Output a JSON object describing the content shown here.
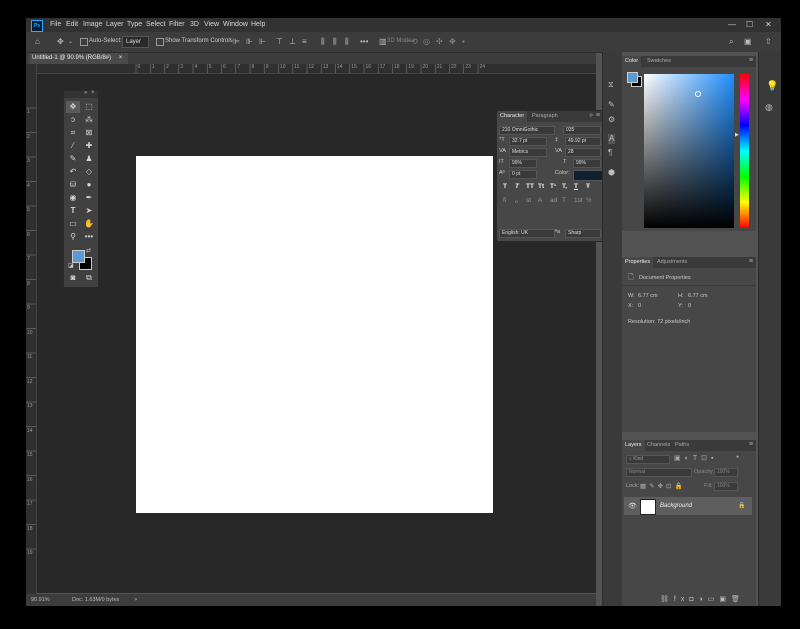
{
  "app": {
    "logo": "Ps",
    "menu": [
      "File",
      "Edit",
      "Image",
      "Layer",
      "Type",
      "Select",
      "Filter",
      "3D",
      "View",
      "Window",
      "Help"
    ],
    "window_controls": {
      "minimize": "—",
      "restore": "☐",
      "close": "✕"
    }
  },
  "options_bar": {
    "auto_select_label": "Auto-Select:",
    "auto_select_target": "Layer",
    "show_transform_label": "Show Transform Controls",
    "mode_3d_label": "3D Mode:"
  },
  "document": {
    "tab_title": "Untitled-1 @ 90.9% (RGB/8#)",
    "tab_close": "×",
    "ruler_h_marks": [
      "0",
      "1",
      "2",
      "3",
      "4",
      "5",
      "6",
      "7",
      "8",
      "9",
      "10",
      "11",
      "12",
      "13",
      "14",
      "15",
      "16",
      "17",
      "18",
      "19",
      "20",
      "21",
      "22",
      "23",
      "24"
    ],
    "ruler_v_marks": [
      "1",
      "2",
      "3",
      "4",
      "5",
      "6",
      "7",
      "8",
      "9",
      "10",
      "11",
      "12",
      "13",
      "14",
      "15",
      "16",
      "17",
      "18",
      "19"
    ],
    "canvas_color": "#ffffff"
  },
  "status": {
    "zoom": "90.91%",
    "doc_size": "Doc: 1.63M/0 bytes",
    "arrow": ">"
  },
  "colors": {
    "foreground": "#5b9bd5",
    "background": "#000000",
    "accent": "#31a8ff"
  },
  "character_panel": {
    "tab_character": "Character",
    "tab_paragraph": "Paragraph",
    "font_family": "210 OmniGothic",
    "font_style": "035",
    "font_size": "32.7 pt",
    "leading": "49.92 pt",
    "kerning": "Metrics",
    "tracking": "28",
    "vertical_scale": "99%",
    "horizontal_scale": "99%",
    "baseline_shift": "0 pt",
    "color_label": "Color:",
    "color_value": "#0f2033",
    "language": "English: UK",
    "aa_prefix": "ªa",
    "antialias": "Sharp",
    "format_buttons": [
      "T",
      "T",
      "TT",
      "Tt",
      "T¹",
      "T,",
      "T",
      "Ŧ"
    ],
    "opentype_buttons": [
      "fi",
      "ℴ",
      "st",
      "A",
      "ad",
      "T",
      "1st",
      "½"
    ]
  },
  "color_panel": {
    "tab_color": "Color",
    "tab_swatches": "Swatches"
  },
  "properties_panel": {
    "tab_properties": "Properties",
    "tab_adjustments": "Adjustments",
    "doc_props_label": "Document Properties",
    "w_label": "W:",
    "w_value": "6.77 cm",
    "h_label": "H:",
    "h_value": "6.77 cm",
    "x_label": "X:",
    "x_value": "0",
    "y_label": "Y:",
    "y_value": "0",
    "resolution": "Resolution: 72 pixels/inch"
  },
  "layers_panel": {
    "tab_layers": "Layers",
    "tab_channels": "Channels",
    "tab_paths": "Paths",
    "filter_kind": "Kind",
    "blend_mode": "Normal",
    "opacity_label": "Opacity:",
    "opacity_value": "100%",
    "lock_label": "Lock:",
    "fill_label": "Fill:",
    "fill_value": "100%",
    "layer_name": "Background"
  }
}
